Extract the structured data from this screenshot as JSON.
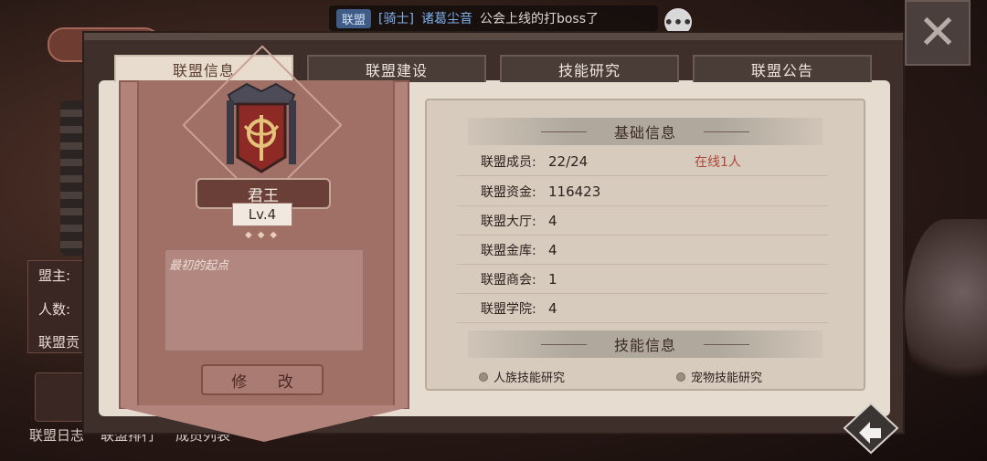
{
  "chat": {
    "channel": "联盟",
    "role": "[骑士]",
    "name": "诸葛尘音",
    "message": "公会上线的打boss了",
    "menu_glyph": "•••"
  },
  "background": {
    "labels": [
      "盟主:",
      "人数:",
      "联盟贡"
    ],
    "bottom_links": [
      "联盟日志",
      "联盟排行",
      "成员列表"
    ]
  },
  "tabs": [
    {
      "label": "联盟信息",
      "active": true
    },
    {
      "label": "联盟建设",
      "active": false
    },
    {
      "label": "技能研究",
      "active": false
    },
    {
      "label": "联盟公告",
      "active": false
    }
  ],
  "guild": {
    "title": "君王",
    "level": "Lv.4",
    "notice": "最初的起点",
    "edit_label": "修 改"
  },
  "basic_info": {
    "title": "基础信息",
    "rows": [
      {
        "key": "联盟成员:",
        "value": "22/24",
        "extra": "在线1人"
      },
      {
        "key": "联盟资金:",
        "value": "116423",
        "extra": ""
      },
      {
        "key": "联盟大厅:",
        "value": "4",
        "extra": ""
      },
      {
        "key": "联盟金库:",
        "value": "4",
        "extra": ""
      },
      {
        "key": "联盟商会:",
        "value": "1",
        "extra": ""
      },
      {
        "key": "联盟学院:",
        "value": "4",
        "extra": ""
      }
    ]
  },
  "skill_info": {
    "title": "技能信息",
    "items": [
      "人族技能研究",
      "宠物技能研究"
    ]
  },
  "colors": {
    "accent_red": "#b0463a",
    "panel": "#e6dccf",
    "banner": "#b2837a"
  }
}
